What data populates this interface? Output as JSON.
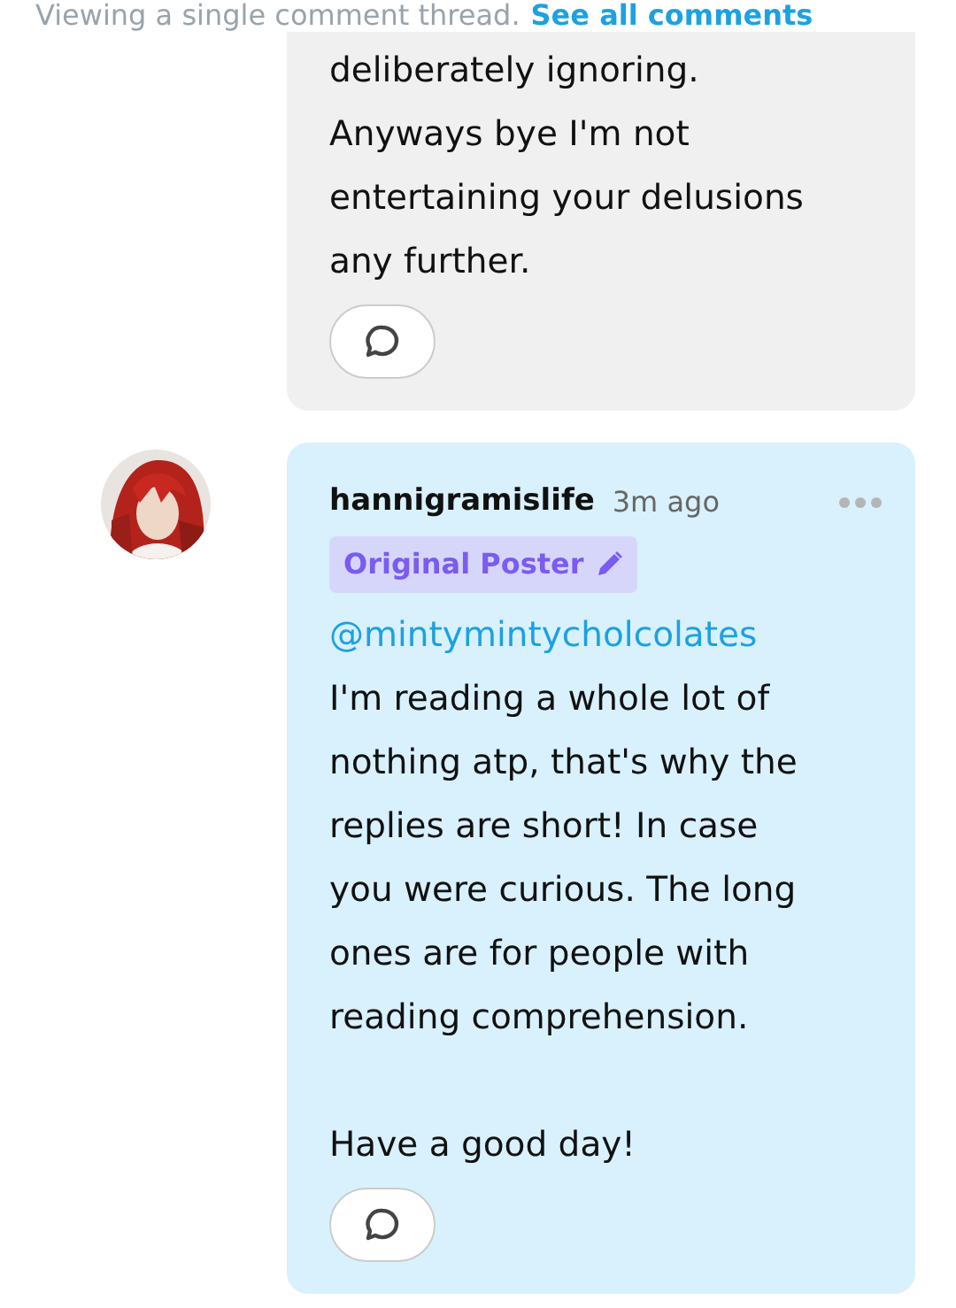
{
  "banner": {
    "text": "Viewing a single comment thread.",
    "link": "See all comments"
  },
  "comments": [
    {
      "kind": "plain",
      "body": "deliberately ignoring.\nAnyways bye I'm not\nentertaining your delusions\nany further."
    },
    {
      "kind": "op",
      "author": "hannigramislife",
      "time": "3m ago",
      "badge": "Original Poster",
      "mention": "@mintymintycholcolates",
      "body": "I'm reading a whole lot of\nnothing atp, that's why the\nreplies are short! In case\nyou were curious. The long\nones are for people with\nreading comprehension.\n\nHave a good day!"
    }
  ]
}
